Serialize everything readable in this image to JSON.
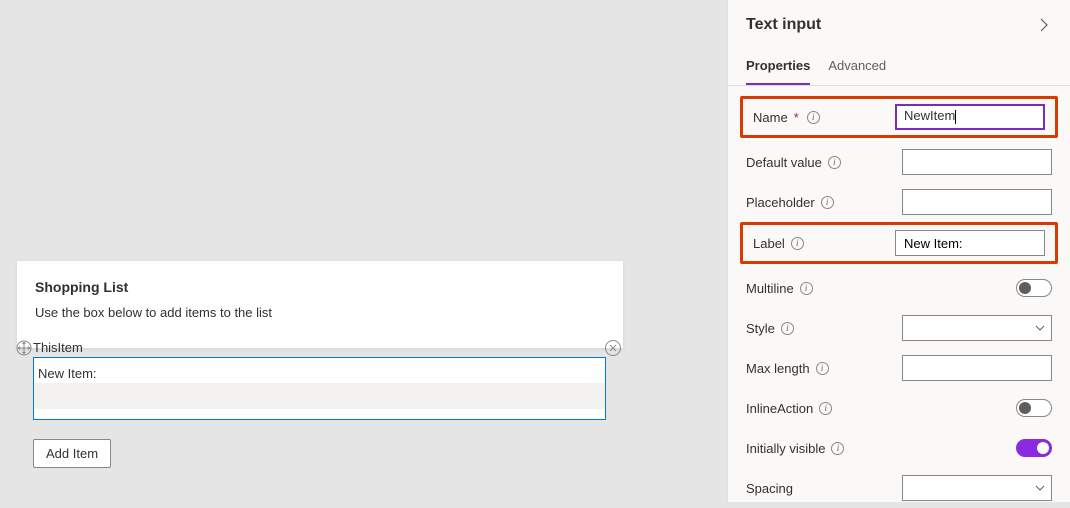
{
  "canvas": {
    "card_title": "Shopping List",
    "card_subtitle": "Use the box below to add items to the list",
    "selected_item_name": "ThisItem",
    "field_label": "New Item:",
    "field_value": "",
    "add_button_label": "Add Item"
  },
  "panel": {
    "title": "Text input",
    "tabs": {
      "properties": "Properties",
      "advanced": "Advanced"
    },
    "props": {
      "name_label": "Name",
      "name_value": "NewItem",
      "default_value_label": "Default value",
      "default_value": "",
      "placeholder_label": "Placeholder",
      "placeholder_value": "",
      "label_label": "Label",
      "label_value": "New Item:",
      "multiline_label": "Multiline",
      "multiline_value": false,
      "style_label": "Style",
      "style_value": "",
      "max_length_label": "Max length",
      "max_length_value": "",
      "inline_action_label": "InlineAction",
      "inline_action_value": false,
      "initially_visible_label": "Initially visible",
      "initially_visible_value": true,
      "spacing_label": "Spacing",
      "spacing_value": ""
    }
  }
}
